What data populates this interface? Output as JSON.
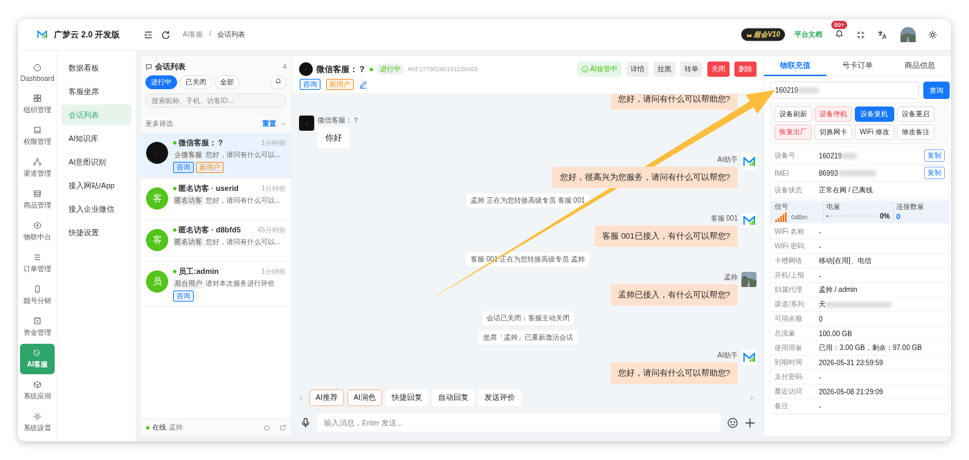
{
  "app": {
    "title": "广梦云 2.0 开发版"
  },
  "breadcrumb": {
    "items": [
      "AI客服",
      "会话列表"
    ],
    "separator": "/"
  },
  "header": {
    "badge": "超会V10",
    "docs_link": "平台文档",
    "notification_count": "99+"
  },
  "rail": [
    {
      "label": "Dashboard",
      "selected": false
    },
    {
      "label": "组织管理",
      "selected": false
    },
    {
      "label": "权限管理",
      "selected": false
    },
    {
      "label": "渠道管理",
      "selected": false
    },
    {
      "label": "商品管理",
      "selected": false
    },
    {
      "label": "物联中台",
      "selected": false
    },
    {
      "label": "订单管理",
      "selected": false
    },
    {
      "label": "靓号分销",
      "selected": false
    },
    {
      "label": "资金管理",
      "selected": false
    },
    {
      "label": "AI客服",
      "selected": true
    },
    {
      "label": "系统应用",
      "selected": false
    },
    {
      "label": "系统设置",
      "selected": false
    }
  ],
  "submenu": [
    {
      "label": "数据看板",
      "selected": false
    },
    {
      "label": "客服坐席",
      "selected": false
    },
    {
      "label": "会话列表",
      "selected": true
    },
    {
      "label": "AI知识库",
      "selected": false
    },
    {
      "label": "AI意图识别",
      "selected": false
    },
    {
      "label": "接入网站/App",
      "selected": false
    },
    {
      "label": "接入企业微信",
      "selected": false
    },
    {
      "label": "快捷设置",
      "selected": false
    }
  ],
  "session_list": {
    "title": "会话列表",
    "count": "4",
    "filters": [
      {
        "label": "进行中",
        "selected": true
      },
      {
        "label": "已关闭",
        "selected": false
      },
      {
        "label": "全部",
        "selected": false
      }
    ],
    "search_placeholder": "搜索昵称、手机、访客ID...",
    "more_filters": "更多筛选",
    "reset": "重置",
    "items": [
      {
        "avatar": {
          "kind": "dark"
        },
        "name": "微信客服：？",
        "time": "1分钟前",
        "source": "企微客服",
        "preview": "您好，请问有什么可以...",
        "tags": [
          {
            "label": "咨询",
            "color": "#1677ff"
          },
          {
            "label": "新用户",
            "color": "#fa8c16"
          }
        ],
        "selected": true
      },
      {
        "avatar": {
          "kind": "char",
          "text": "客"
        },
        "name": "匿名访客 · userid",
        "time": "1分钟前",
        "source": "匿名访客",
        "preview": "您好，请问有什么可以...",
        "selected": false
      },
      {
        "avatar": {
          "kind": "char",
          "text": "客"
        },
        "name": "匿名访客 · d8bfd5",
        "time": "45分钟前",
        "source": "匿名访客",
        "preview": "您好，请问有什么可以...",
        "selected": false
      },
      {
        "avatar": {
          "kind": "char",
          "text": "员"
        },
        "name": "员工:admin",
        "time": "1分钟前",
        "source": "后台用户",
        "preview": "请对本次服务进行评价",
        "tags": [
          {
            "label": "咨询",
            "color": "#1677ff"
          }
        ],
        "selected": false
      }
    ],
    "footer_status": "在线",
    "footer_user": "孟帅"
  },
  "chat": {
    "title": "微信客服：？",
    "status": "进行中",
    "session_id": "#KF17790280161138403",
    "tags": [
      {
        "label": "咨询",
        "color": "#1677ff"
      },
      {
        "label": "新用户",
        "color": "#fa8c16"
      }
    ],
    "actions": [
      {
        "label": "AI接管中",
        "kind": "ai"
      },
      {
        "label": "详情",
        "kind": "plain"
      },
      {
        "label": "拉黑",
        "kind": "plain"
      },
      {
        "label": "转单",
        "kind": "plain"
      },
      {
        "label": "关闭",
        "kind": "danger"
      },
      {
        "label": "删除",
        "kind": "danger"
      }
    ],
    "messages": [
      {
        "kind": "outgoing",
        "text": "您好，请问有什么可以帮助您?"
      },
      {
        "kind": "incoming",
        "sender": "微信客服：？",
        "text": "你好"
      },
      {
        "kind": "outgoing",
        "avatar": {
          "kind": "logo"
        },
        "sender": "AI助手",
        "text": "您好，很高兴为您服务，请问有什么可以帮您?"
      },
      {
        "kind": "system",
        "text": "孟帅 正在为您转接高级专员 客服 001"
      },
      {
        "kind": "outgoing",
        "avatar": {
          "kind": "logo"
        },
        "sender": "客服 001",
        "text": "客服 001已接入，有什么可以帮您?"
      },
      {
        "kind": "system",
        "text": "客服 001 正在为您转接高级专员 孟帅"
      },
      {
        "kind": "outgoing",
        "sender": "孟帅",
        "text": "孟帅已接入，有什么可以帮您?"
      },
      {
        "kind": "system",
        "text": "会话已关闭：客服主动关闭"
      },
      {
        "kind": "system",
        "text": "坐席「孟帅」已重新激活会话"
      },
      {
        "kind": "outgoing",
        "avatar": {
          "kind": "logo"
        },
        "sender": "AI助手",
        "text": "您好，请问有什么可以帮助您?"
      }
    ],
    "quick_actions": [
      {
        "label": "AI推荐",
        "highlighted": true
      },
      {
        "label": "AI润色",
        "highlighted": true
      },
      {
        "label": "快捷回复",
        "highlighted": false
      },
      {
        "label": "自动回复",
        "highlighted": false
      },
      {
        "label": "发送评价",
        "highlighted": false
      }
    ],
    "input_placeholder": "输入消息，Enter 发送..."
  },
  "device_panel": {
    "tabs": [
      {
        "label": "物联充值",
        "selected": true
      },
      {
        "label": "号卡订单",
        "selected": false
      },
      {
        "label": "商品信息",
        "selected": false
      }
    ],
    "search_value": "160219",
    "search_redacted": true,
    "search_button": "查询",
    "buttons": [
      {
        "label": "设备刷新",
        "kind": "plain"
      },
      {
        "label": "设备停机",
        "kind": "danger"
      },
      {
        "label": "设备复机",
        "kind": "primary"
      },
      {
        "label": "设备重启",
        "kind": "plain"
      },
      {
        "label": "恢复出厂",
        "kind": "danger"
      },
      {
        "label": "切换网卡",
        "kind": "plain"
      },
      {
        "label": "WiFi 修改",
        "kind": "plain"
      },
      {
        "label": "修改备注",
        "kind": "plain"
      }
    ],
    "rows_top": [
      {
        "label": "设备号",
        "value": "160219",
        "redacted": true,
        "action": "复制"
      },
      {
        "label": "IMEI",
        "value": "86993",
        "redacted": true,
        "action": "复制"
      },
      {
        "label": "设备状态",
        "value": "正常在网 / 已离线"
      }
    ],
    "stats": {
      "signal_label": "信号",
      "signal_reading": "0dBm",
      "battery_label": "电量",
      "battery": {
        "level": 0
      },
      "battery_reading": "0%",
      "connections_label": "连接数量",
      "connections": "0"
    },
    "rows": [
      {
        "label": "WiFi 名称",
        "value": "-"
      },
      {
        "label": "WiFi 密码",
        "value": "-"
      },
      {
        "label": "卡槽网络",
        "value": "移动[在用]、电信"
      },
      {
        "label": "开机/上报",
        "value": "-"
      },
      {
        "label": "归属代理",
        "value": "孟帅 / admin"
      },
      {
        "label": "渠道/系列",
        "value": "天",
        "redacted": true
      },
      {
        "label": "可用余额",
        "value": "0"
      },
      {
        "label": "总流量",
        "value": "100.00 GB"
      },
      {
        "label": "使用用量",
        "value": "已用：3.00 GB，剩余：97.00 GB"
      },
      {
        "label": "到期时间",
        "value": "2026-05-31 23:59:59"
      },
      {
        "label": "支付密码",
        "value": "-"
      },
      {
        "label": "最近访问",
        "value": "2026-05-08 21:29:09"
      },
      {
        "label": "备注",
        "value": "-"
      }
    ]
  }
}
